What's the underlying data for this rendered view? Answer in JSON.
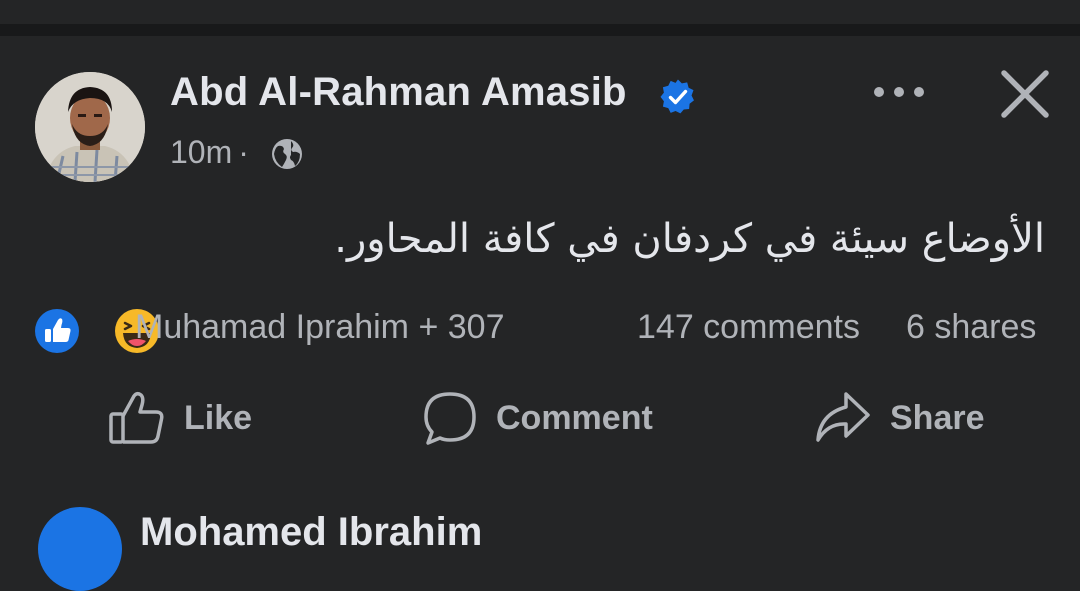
{
  "post": {
    "author": "Abd Al-Rahman Amasib",
    "time": "10m",
    "separator": "·",
    "audience_icon": "globe-icon",
    "text": "الأوضاع سيئة في كردفان في كافة المحاور.",
    "reactions": {
      "icons": [
        "like-reaction-icon",
        "haha-reaction-icon"
      ],
      "summary": "Muhamad Iprahim + 307"
    },
    "comments_count": "147 comments",
    "shares_count": "6 shares",
    "actions": {
      "like": "Like",
      "comment": "Comment",
      "share": "Share"
    }
  },
  "next_post": {
    "author": "Mohamed Ibrahim"
  },
  "colors": {
    "background": "#242526",
    "divider": "#18191a",
    "primary_text": "#e4e6eb",
    "secondary_text": "#b0b3b8",
    "verified_blue": "#1b74e4",
    "haha_yellow": "#f7b928"
  }
}
